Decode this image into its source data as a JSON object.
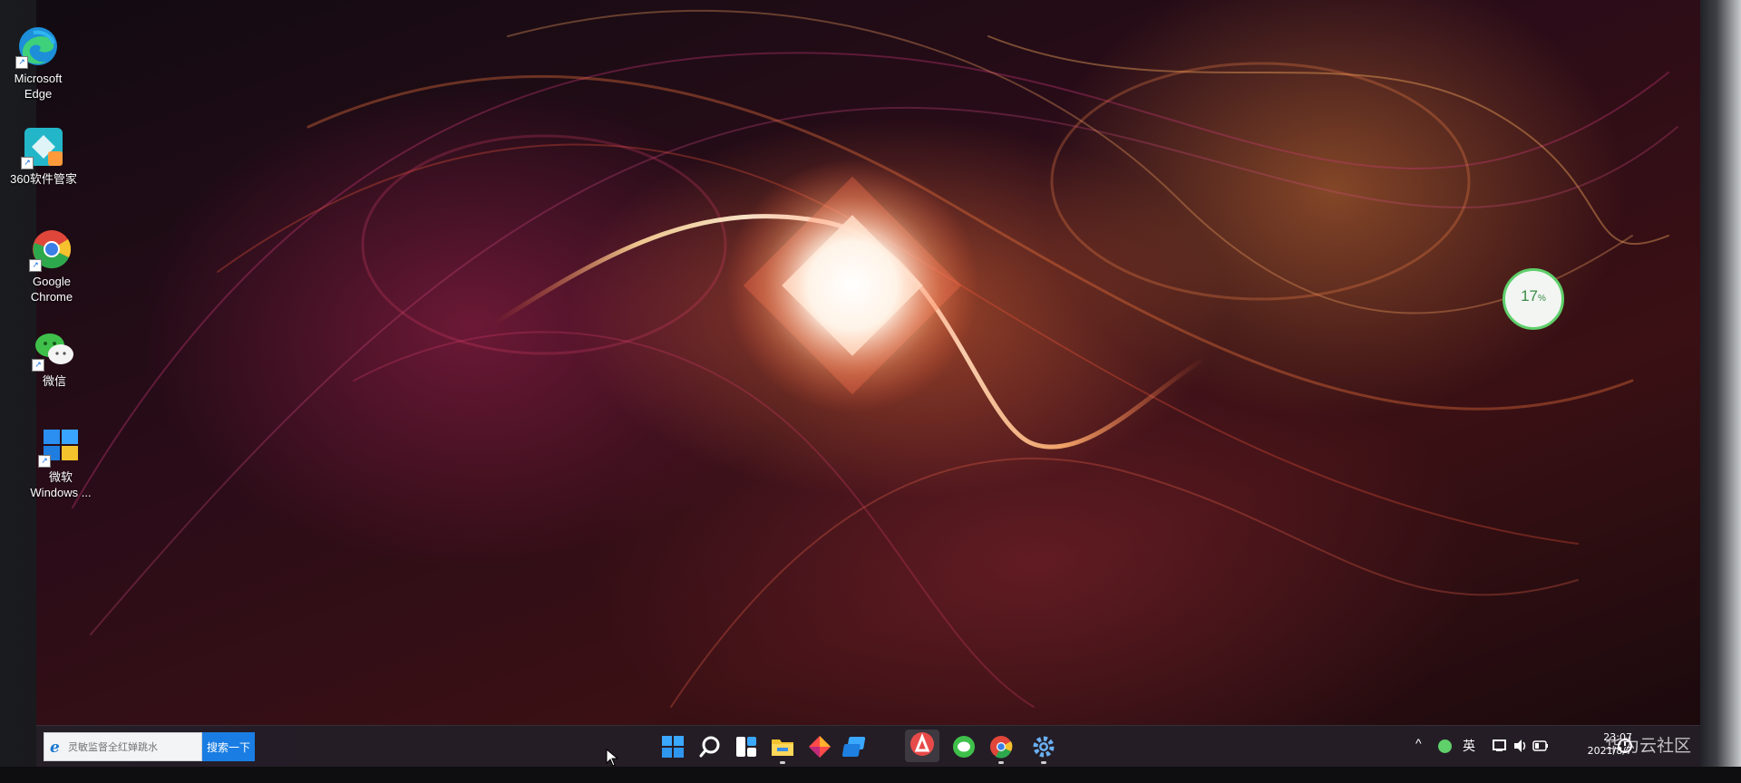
{
  "desktop": {
    "icons": [
      {
        "name": "Microsoft Edge",
        "label": "Microsoft\nEdge"
      },
      {
        "name": "360软件管家",
        "label": "360软件管家"
      },
      {
        "name": "Google Chrome",
        "label": "Google\nChrome"
      },
      {
        "name": "微信",
        "label": "微信"
      },
      {
        "name": "微软 Windows",
        "label": "微软\nWindows ..."
      }
    ]
  },
  "battery_widget": {
    "value": "17",
    "unit": "%",
    "level": 0.17
  },
  "taskbar": {
    "search": {
      "placeholder": "灵敏监督全红婵跳水",
      "button_label": "搜索一下"
    },
    "apps": [
      {
        "icon": "windows-start-icon",
        "active": false
      },
      {
        "icon": "search-icon",
        "active": false
      },
      {
        "icon": "widgets-icon",
        "active": false
      },
      {
        "icon": "file-explorer-icon",
        "active": true
      },
      {
        "icon": "colorful-app-icon",
        "active": false
      },
      {
        "icon": "blue-app-icon",
        "active": false
      },
      {
        "icon": "red-app-icon",
        "active": true
      },
      {
        "icon": "wechat-icon",
        "active": false
      },
      {
        "icon": "chrome-icon",
        "active": true
      },
      {
        "icon": "settings-icon",
        "active": true
      }
    ],
    "tray": {
      "input_method": "英",
      "time": "23:07",
      "date": "2021/8/7"
    }
  },
  "watermark": "华为云社区",
  "colors": {
    "taskbar": "#261e28",
    "search_button": "#1a7de3",
    "battery_ring": "#5fcf6a"
  }
}
